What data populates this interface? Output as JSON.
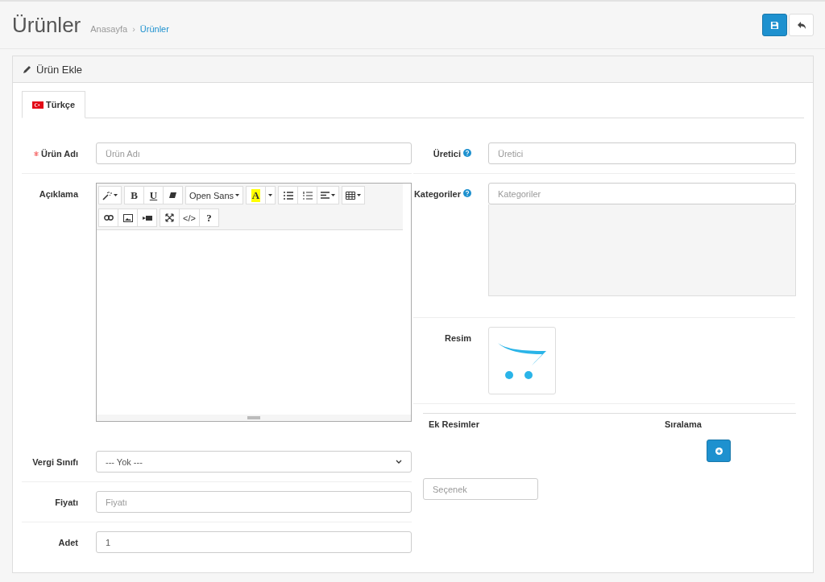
{
  "header": {
    "title": "Ürünler",
    "breadcrumb": [
      {
        "label": "Anasayfa",
        "active": false
      },
      {
        "label": "Ürünler",
        "active": true
      }
    ],
    "breadcrumb_separator": "›",
    "actions": [
      {
        "kind": "save"
      },
      {
        "kind": "back"
      }
    ]
  },
  "panel": {
    "title": "Ürün Ekle",
    "tabs": [
      {
        "label": "Türkçe",
        "selected": true
      }
    ]
  },
  "left_fields": [
    {
      "kind": "input",
      "label": "Ürün Adı",
      "required": true,
      "placeholder": "Ürün Adı"
    },
    {
      "kind": "editor",
      "label": "Açıklama",
      "required": false,
      "toolbar": [
        [
          {
            "kind": "magic"
          }
        ],
        [
          {
            "kind": "bold",
            "text": "B"
          },
          {
            "kind": "underline",
            "text": "U"
          },
          {
            "kind": "eraser"
          }
        ],
        [
          {
            "kind": "font",
            "text": "Open Sans"
          }
        ],
        [
          {
            "kind": "color",
            "text": "A"
          },
          {
            "kind": "color-menu"
          }
        ],
        [
          {
            "kind": "bullets"
          },
          {
            "kind": "numbers"
          },
          {
            "kind": "align"
          }
        ],
        [
          {
            "kind": "table"
          }
        ],
        [
          {
            "kind": "link"
          },
          {
            "kind": "picture"
          },
          {
            "kind": "video"
          }
        ],
        [
          {
            "kind": "fullscreen"
          },
          {
            "kind": "code",
            "text": "</>"
          },
          {
            "kind": "help",
            "text": "?"
          }
        ]
      ]
    },
    {
      "kind": "select",
      "label": "Vergi Sınıfı",
      "required": false,
      "value": "--- Yok ---"
    },
    {
      "kind": "input",
      "label": "Fiyatı",
      "required": false,
      "placeholder": "Fiyatı"
    },
    {
      "kind": "input",
      "label": "Adet",
      "required": false,
      "value": "1"
    }
  ],
  "right_fields": [
    {
      "kind": "input",
      "label": "Üretici",
      "help": true,
      "placeholder": "Üretici"
    },
    {
      "kind": "list",
      "label": "Kategoriler",
      "help": true,
      "placeholder": "Kategoriler"
    },
    {
      "kind": "image",
      "label": "Resim",
      "help": false
    }
  ],
  "extra_images": {
    "columns": [
      "Ek Resimler",
      "Sıralama"
    ]
  },
  "option": {
    "placeholder": "Seçenek"
  }
}
